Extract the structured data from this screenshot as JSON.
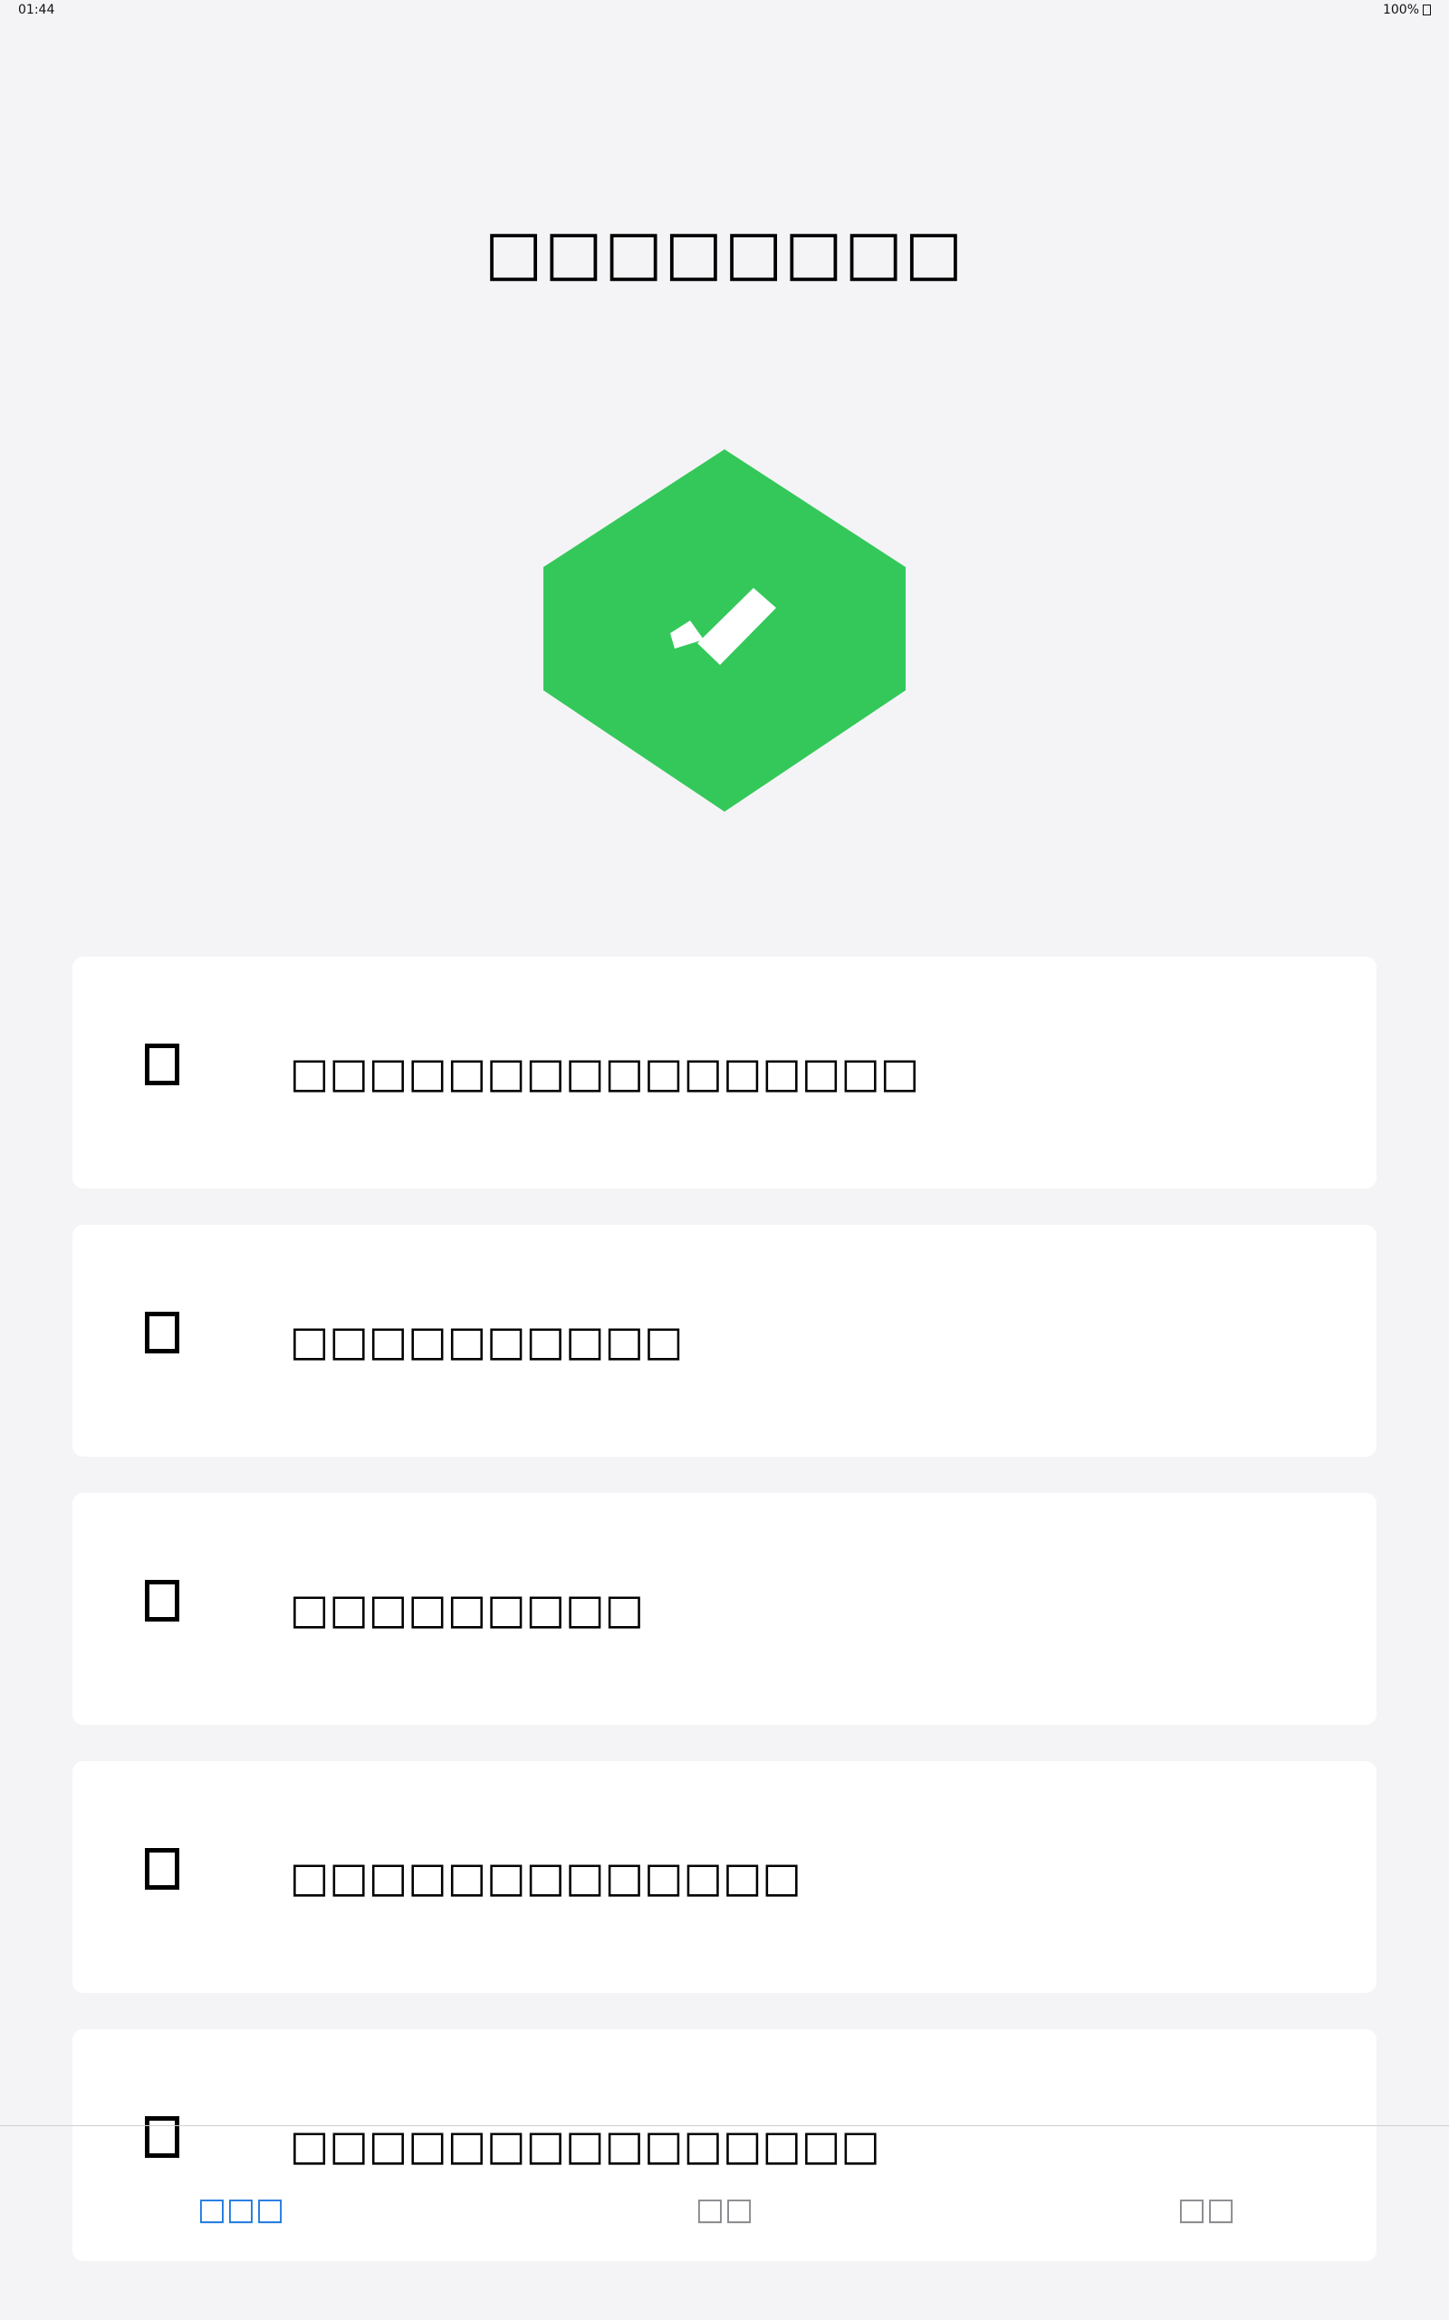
{
  "status_bar": {
    "time": "01:44",
    "battery": "100%"
  },
  "page": {
    "title": "□□□□□□□□"
  },
  "badge": {
    "icon": "check-hexagon-icon",
    "color": "#34c85a"
  },
  "cards": [
    {
      "icon": "item-icon",
      "label": "□□□□□□□□□□□□□□□□"
    },
    {
      "icon": "item-icon",
      "label": "□□□□□□□□□□"
    },
    {
      "icon": "item-icon",
      "label": "□□□□□□□□□"
    },
    {
      "icon": "item-icon",
      "label": "□□□□□□□□□□□□□"
    },
    {
      "icon": "item-icon",
      "label": "□□□□□□□□□□□□□□□"
    }
  ],
  "tabs": [
    {
      "label": "□□□",
      "active": true
    },
    {
      "label": "□□",
      "active": false
    },
    {
      "label": "□□",
      "active": false
    }
  ],
  "colors": {
    "accent": "#1f7ae0",
    "inactive_tab": "#8a8a8e",
    "background": "#f4f4f6",
    "card": "#ffffff",
    "badge_green": "#34c85a"
  }
}
